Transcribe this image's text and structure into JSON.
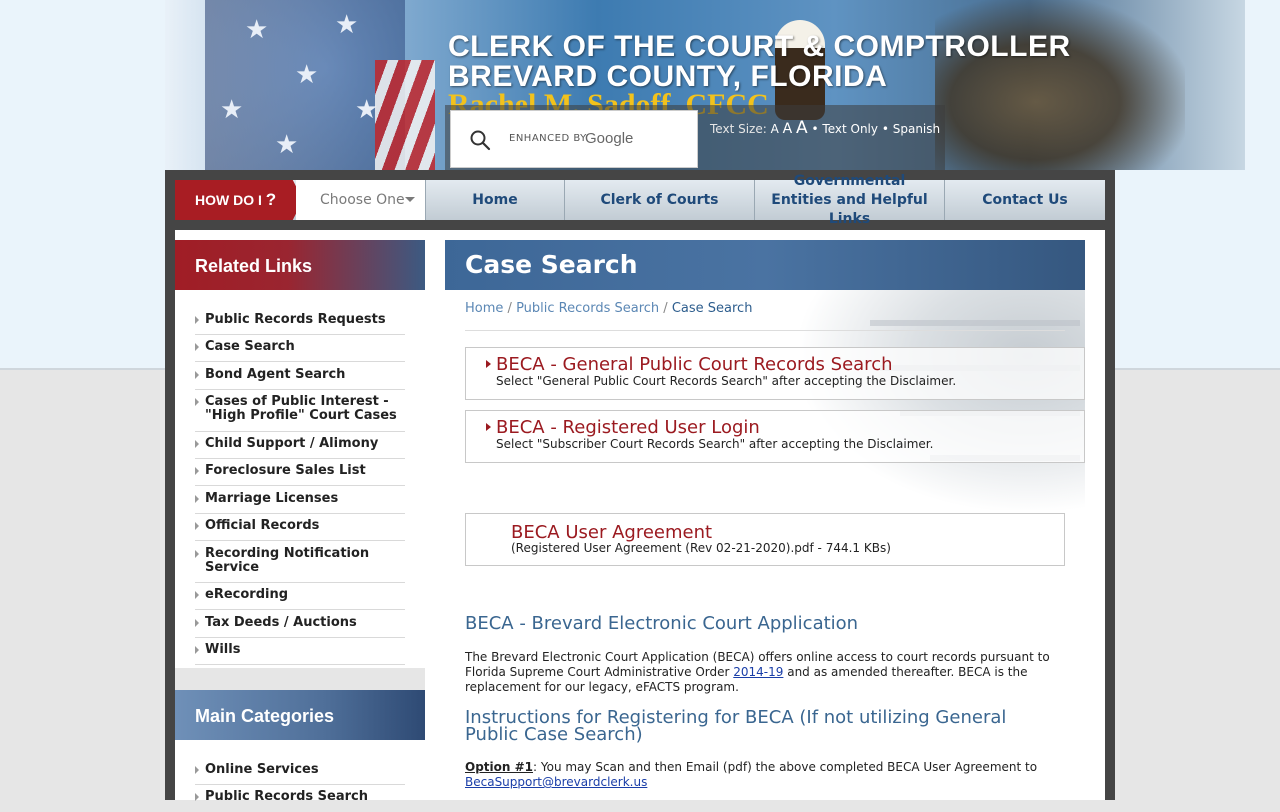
{
  "header": {
    "title_line1": "CLERK OF THE COURT & COMPTROLLER",
    "title_line2": "BREVARD COUNTY, FLORIDA",
    "title_line3": "Rachel M. Sadoff, CFCC",
    "search": {
      "enhanced_by": "ENHANCED BY",
      "provider": "Google"
    },
    "tools": {
      "text_size_label": "Text Size:",
      "size_small": "A",
      "size_medium": "A",
      "size_large": "A",
      "bullet": "•",
      "text_only": "Text Only",
      "spanish": "Spanish"
    }
  },
  "nav": {
    "how_do_i": "HOW DO I",
    "how_do_i_q": "?",
    "choose": "Choose One",
    "items": [
      {
        "label": "Home"
      },
      {
        "label": "Clerk of Courts"
      },
      {
        "label": "Governmental Entities and Helpful Links"
      },
      {
        "label": "Contact Us"
      }
    ]
  },
  "sidebar": {
    "related_title": "Related Links",
    "related_items": [
      {
        "label": "Public Records Requests"
      },
      {
        "label": "Case Search"
      },
      {
        "label": "Bond Agent Search"
      },
      {
        "label": "Cases of Public Interest - \"High Profile\" Court Cases"
      },
      {
        "label": "Child Support / Alimony"
      },
      {
        "label": "Foreclosure Sales List"
      },
      {
        "label": "Marriage Licenses"
      },
      {
        "label": "Official Records"
      },
      {
        "label": "Recording Notification Service"
      },
      {
        "label": "eRecording"
      },
      {
        "label": "Tax Deeds / Auctions"
      },
      {
        "label": "Wills"
      }
    ],
    "main_title": "Main Categories",
    "main_items": [
      {
        "label": "Online Services"
      },
      {
        "label": "Public Records Search"
      }
    ]
  },
  "main": {
    "title": "Case Search",
    "breadcrumb": {
      "home": "Home",
      "sep": "/",
      "parent": "Public Records Search",
      "current": "Case Search"
    },
    "links": [
      {
        "title": "BECA - General Public Court Records Search",
        "desc": "Select \"General Public Court Records Search\" after accepting the Disclaimer."
      },
      {
        "title": "BECA - Registered User Login",
        "desc": "Select \"Subscriber Court Records Search\" after accepting the Disclaimer."
      }
    ],
    "agreement": {
      "title": "BECA User Agreement",
      "desc": "(Registered User Agreement (Rev 02-21-2020).pdf - 744.1 KBs)"
    },
    "section1_title": "BECA - Brevard Electronic Court Application",
    "para1_a": "The Brevard Electronic Court Application (BECA) offers online access to court records pursuant to Florida Supreme Court Administrative Order ",
    "para1_link": "2014-19",
    "para1_b": " and as amended thereafter.  BECA is the replacement for our legacy, eFACTS program.",
    "section2_title": "Instructions for Registering for BECA (If not utilizing General Public Case Search)",
    "option1_label": "Option #1",
    "option1_text": ":  You may Scan and then Email (pdf) the above completed BECA User Agreement to ",
    "option1_email": "BecaSupport@brevardclerk.us"
  },
  "colors": {
    "brand_red": "#a81d23",
    "brand_blue": "#3d6797",
    "link_red": "#9b1a20"
  }
}
